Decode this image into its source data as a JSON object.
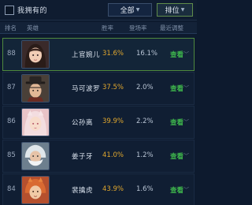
{
  "top_bar": {
    "own_filter_label": "我拥有的",
    "all_dropdown_label": "全部",
    "sort_dropdown_label": "排位"
  },
  "columns": {
    "rank": "排名",
    "hero": "英雄",
    "win_rate": "胜率",
    "pick_rate": "登场率",
    "recent": "最近调整"
  },
  "rows": [
    {
      "rank": "88",
      "name": "上官婉儿",
      "win_rate": "31.6%",
      "pick_rate": "16.1%",
      "action": "查看"
    },
    {
      "rank": "87",
      "name": "马可波罗",
      "win_rate": "37.5%",
      "pick_rate": "2.0%",
      "action": "查看"
    },
    {
      "rank": "86",
      "name": "公孙离",
      "win_rate": "39.9%",
      "pick_rate": "2.2%",
      "action": "查看"
    },
    {
      "rank": "85",
      "name": "姜子牙",
      "win_rate": "41.0%",
      "pick_rate": "1.2%",
      "action": "查看"
    },
    {
      "rank": "84",
      "name": "裴擒虎",
      "win_rate": "43.9%",
      "pick_rate": "1.6%",
      "action": "查看"
    }
  ],
  "colors": {
    "win_rate": "#e0a72e",
    "action": "#3fb94d",
    "selected_border": "#4f8a3e"
  }
}
